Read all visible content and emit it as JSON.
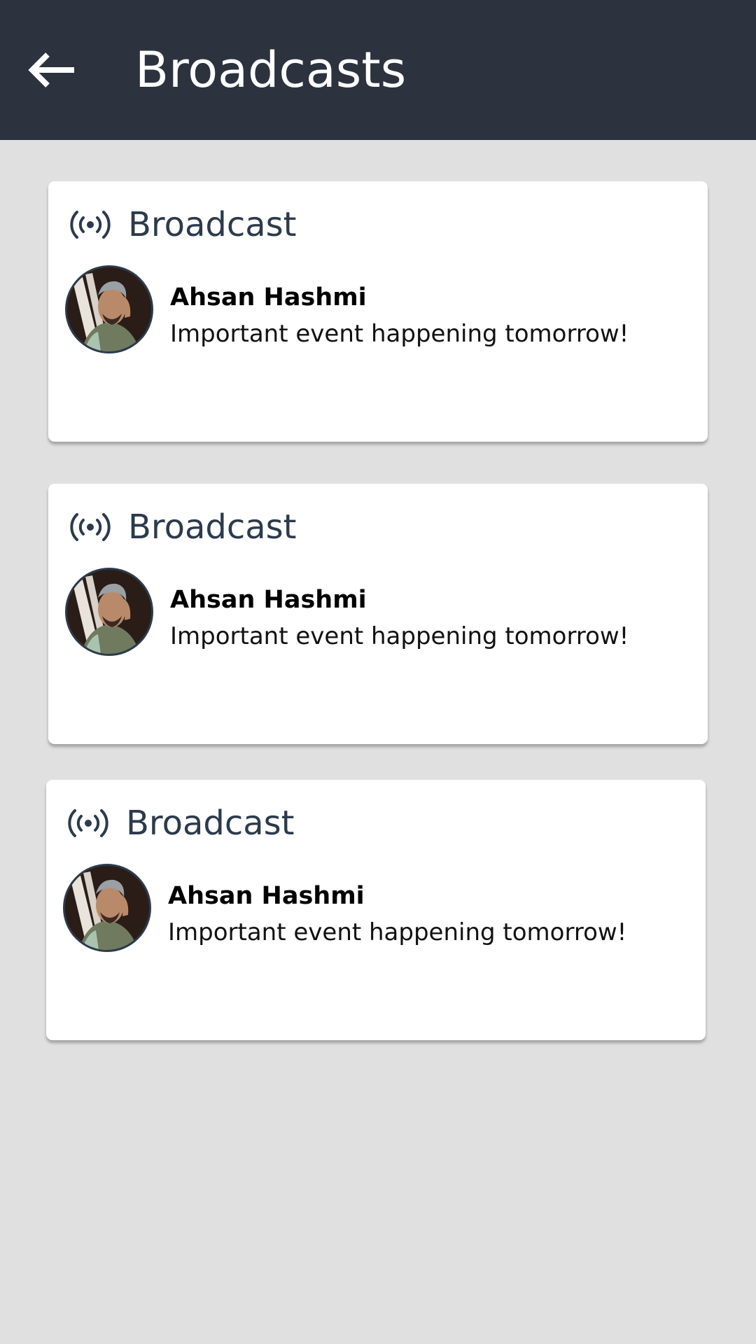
{
  "header": {
    "title": "Broadcasts",
    "back_icon": "arrow-left-icon",
    "background": "#2c333e"
  },
  "broadcasts": [
    {
      "title": "Broadcast",
      "icon": "broadcast-icon",
      "author": "Ahsan Hashmi",
      "message": "Important event happening tomorrow!"
    },
    {
      "title": "Broadcast",
      "icon": "broadcast-icon",
      "author": "Ahsan Hashmi",
      "message": "Important event happening tomorrow!"
    },
    {
      "title": "Broadcast",
      "icon": "broadcast-icon",
      "author": "Ahsan Hashmi",
      "message": "Important event happening tomorrow!"
    }
  ],
  "colors": {
    "accent": "#2c3a4c",
    "page_background": "#e0e0e0",
    "card_background": "#ffffff"
  }
}
